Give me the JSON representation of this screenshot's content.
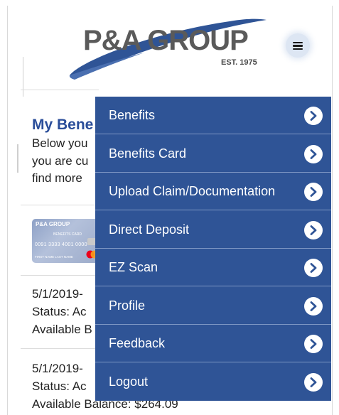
{
  "brand": {
    "name": "P&A GROUP",
    "est": "EST. 1975",
    "text_color": "#5a5a5a",
    "swoosh_color": "#2f5496"
  },
  "header": {
    "menu_icon": "hamburger-icon"
  },
  "content": {
    "section_title": "My Bene",
    "intro_lines": [
      "Below you",
      "you are cu",
      "find more "
    ],
    "card": {
      "logo": "P&A GROUP",
      "subtitle": "BENEFITS CARD",
      "number": "0091 3333 4001 0000",
      "name": "FIRST NAME LAST NAME"
    },
    "entries": [
      {
        "line1": "5/1/2019-",
        "line2": "Status: Ac",
        "line3": "Available B"
      },
      {
        "line1": "5/1/2019-",
        "line2": "Status: Ac",
        "line3": "Available Balance: $264.09"
      }
    ]
  },
  "menu": {
    "background": "#2f5496",
    "items": [
      {
        "label": "Benefits",
        "icon": "chevron-right-icon"
      },
      {
        "label": "Benefits Card",
        "icon": "chevron-right-icon"
      },
      {
        "label": "Upload Claim/Documentation",
        "icon": "chevron-right-icon"
      },
      {
        "label": "Direct Deposit",
        "icon": "chevron-right-icon"
      },
      {
        "label": "EZ Scan",
        "icon": "chevron-right-icon"
      },
      {
        "label": "Profile",
        "icon": "chevron-right-icon"
      },
      {
        "label": "Feedback",
        "icon": "chevron-right-icon"
      },
      {
        "label": "Logout",
        "icon": "chevron-right-icon"
      }
    ]
  }
}
